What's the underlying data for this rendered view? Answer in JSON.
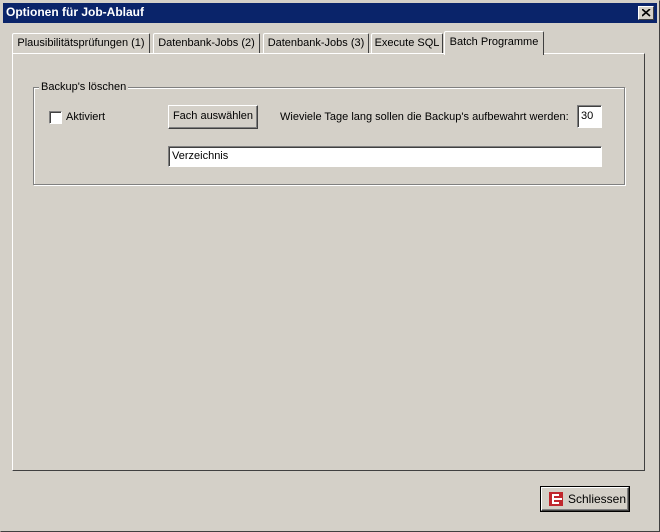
{
  "window": {
    "title": "Optionen für Job-Ablauf"
  },
  "tabs": [
    {
      "label": "Plausibilitätsprüfungen (1)"
    },
    {
      "label": "Datenbank-Jobs (2)"
    },
    {
      "label": "Datenbank-Jobs (3)"
    },
    {
      "label": "Execute SQL"
    },
    {
      "label": "Batch Programme",
      "active": true
    }
  ],
  "group": {
    "legend": "Backup's löschen",
    "checkbox_label": "Aktiviert",
    "checkbox_checked": false,
    "select_button_label": "Fach auswählen",
    "days_label": "Wieviele Tage lang sollen die Backup's aufbewahrt werden:",
    "days_value": "30",
    "directory_value": "Verzeichnis"
  },
  "footer": {
    "close_label": "Schliessen"
  },
  "colors": {
    "title_bar": "#0a246a",
    "face": "#d4d0c8",
    "exit_icon": "#c0272d"
  }
}
